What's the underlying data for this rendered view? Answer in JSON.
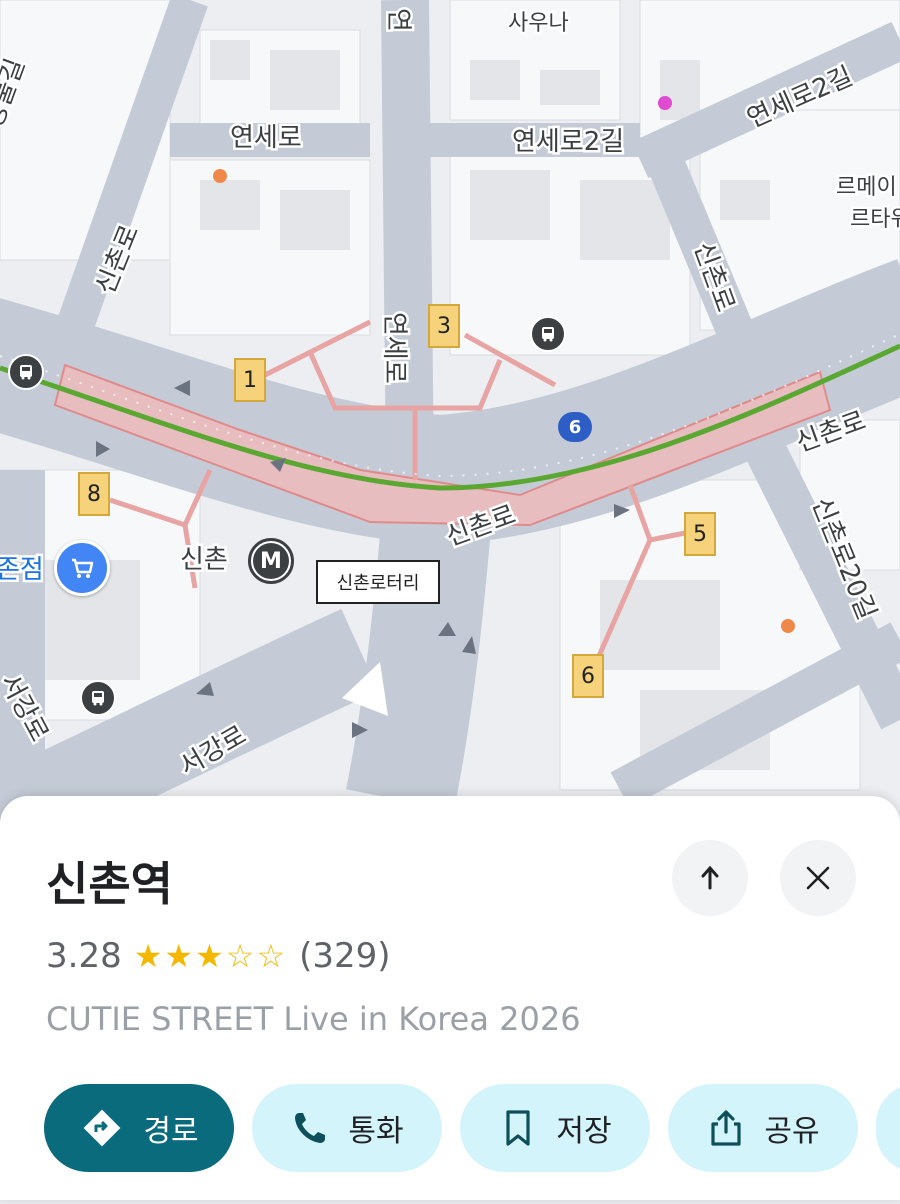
{
  "map": {
    "street_labels": {
      "yonsei_ro": "연세로",
      "yonsei_ro_2gil_a": "연세로2길",
      "yonsei_ro_2gil_b": "연세로2길",
      "sinchon_ro_nw": "신촌로",
      "sinchon_ro_ne": "신촌로",
      "sinchon_ro_e": "신촌로",
      "sinchon_ro_center": "신촌로",
      "sinchon_ro_20gil": "신촌로20길",
      "yonsei_ro_vertical": "연세로",
      "seogang_ro": "서강로",
      "seogang_ro_left": "서강로",
      "top_partial": "연",
      "left_partial": "명물길",
      "store_partial": "존점",
      "right_partial_1": "르메이",
      "right_partial_2": "르타워"
    },
    "sauna": "사우나",
    "station_name": "신촌",
    "metro_symbol": "M",
    "rotary_label": "신촌로터리",
    "bus_route_badge": "6",
    "exits": [
      "1",
      "3",
      "5",
      "6",
      "8"
    ]
  },
  "place": {
    "title": "신촌역",
    "rating": "3.28",
    "stars_display": "★★★☆☆",
    "review_count": "(329)",
    "subtitle": "CUTIE STREET Live in Korea 2026"
  },
  "actions": {
    "directions": "경로",
    "call": "통화",
    "save": "저장",
    "share": "공유"
  },
  "colors": {
    "primary_button": "#0a6b7c",
    "secondary_button": "#d4f4fb",
    "star": "#f5b800",
    "subway_line": "#5aa832",
    "exit_box": "#f6d37a"
  }
}
